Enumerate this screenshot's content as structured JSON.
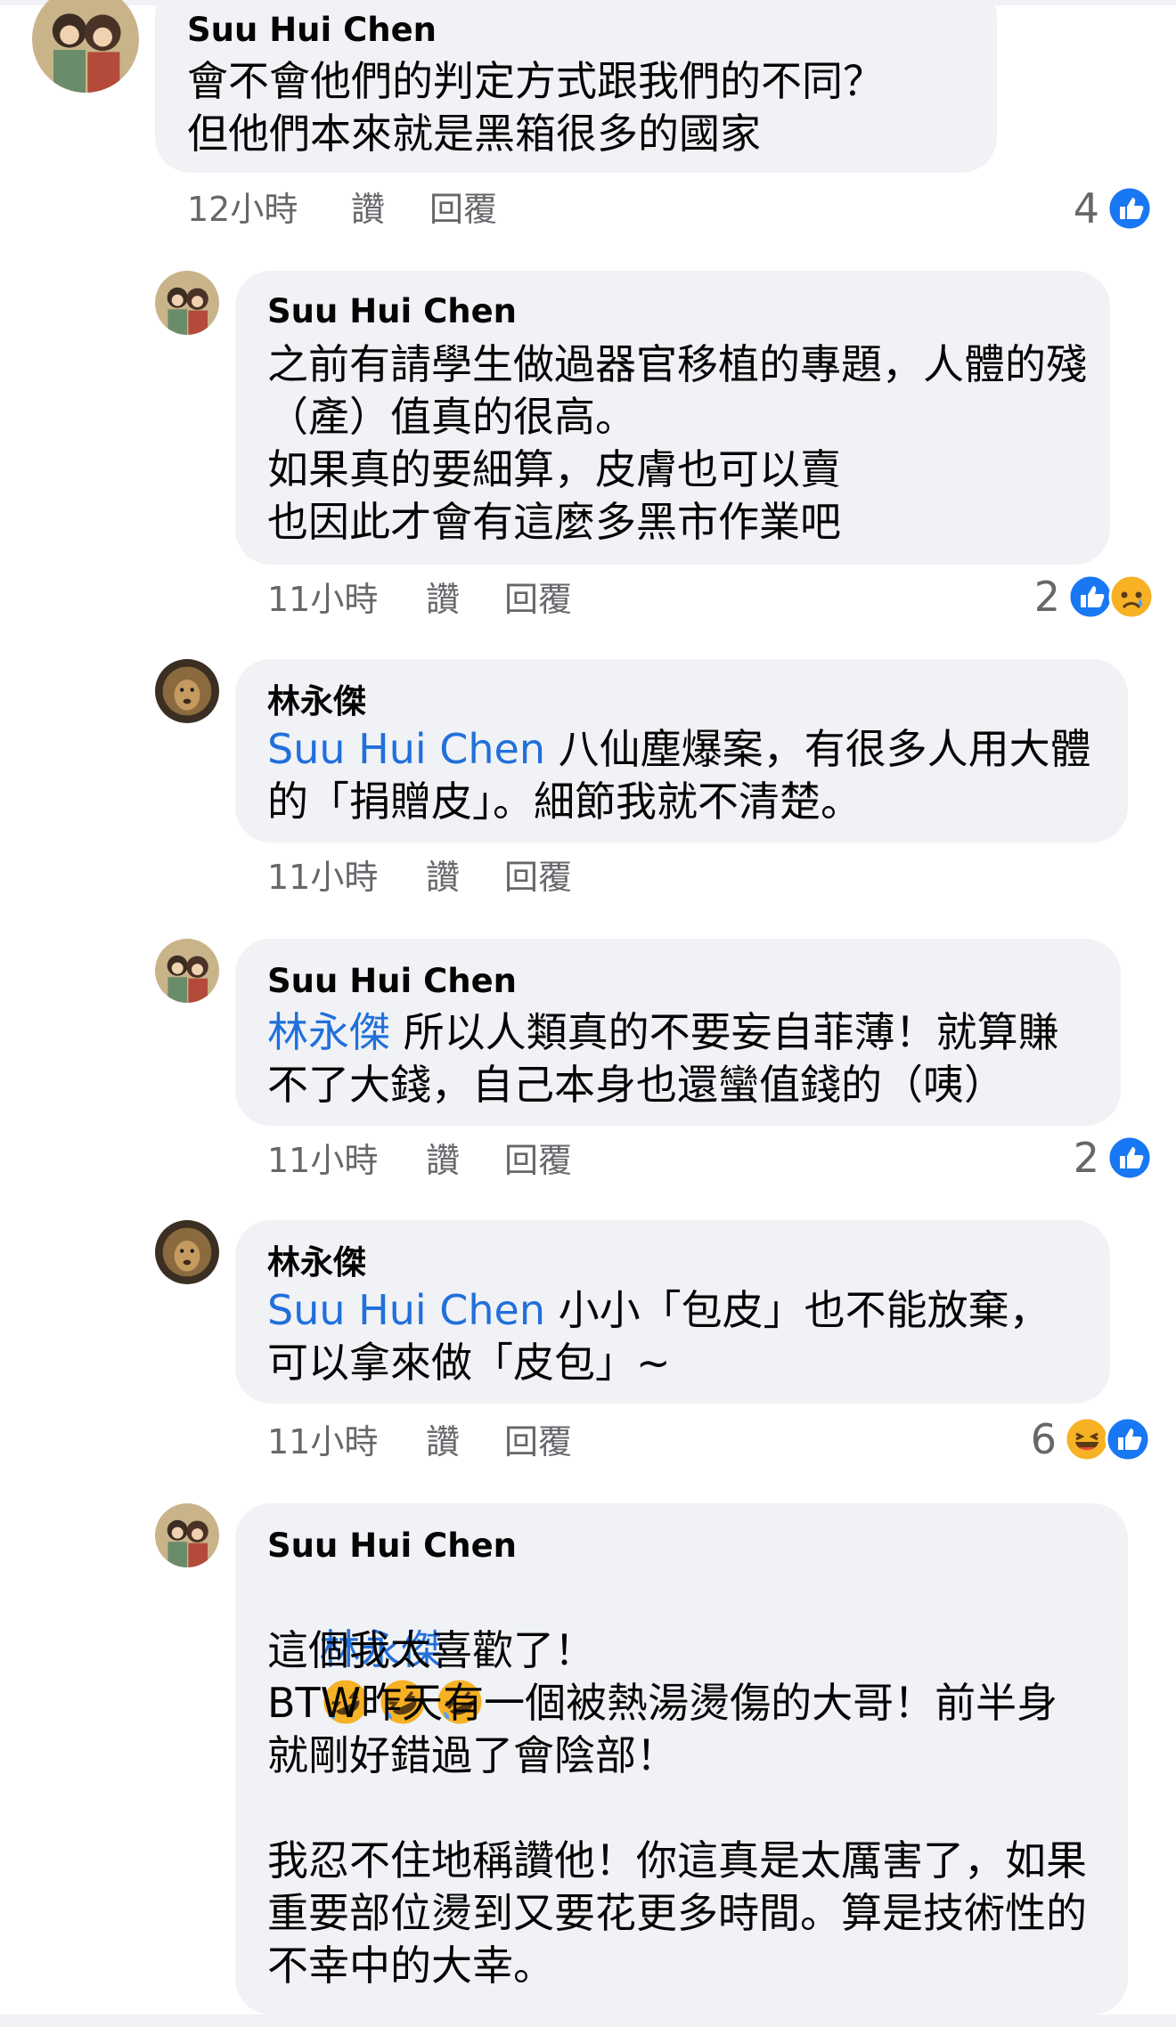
{
  "comments": [
    {
      "author": "Suu Hui Chen",
      "mention": "",
      "text": "會不會他們的判定方式跟我們的不同？\n但他們本來就是黑箱很多的國家",
      "time": "12小時",
      "like_label": "讚",
      "reply_label": "回覆",
      "reaction_count": "4",
      "reactions": [
        "like-icon"
      ]
    },
    {
      "author": "Suu Hui Chen",
      "mention": "",
      "text": "之前有請學生做過器官移植的專題，人體的殘（產）值真的很高。\n如果真的要細算，皮膚也可以賣\n也因此才會有這麼多黑市作業吧",
      "time": "11小時",
      "like_label": "讚",
      "reply_label": "回覆",
      "reaction_count": "2",
      "reactions": [
        "like-icon",
        "sad-icon"
      ]
    },
    {
      "author": "林永傑",
      "mention": "Suu Hui Chen",
      "text": " 八仙塵爆案，有很多人用大體的「捐贈皮」。細節我就不清楚。",
      "time": "11小時",
      "like_label": "讚",
      "reply_label": "回覆",
      "reaction_count": "",
      "reactions": []
    },
    {
      "author": "Suu Hui Chen",
      "mention": "林永傑",
      "text": " 所以人類真的不要妄自菲薄！就算賺不了大錢，自己本身也還蠻值錢的（咦）",
      "time": "11小時",
      "like_label": "讚",
      "reply_label": "回覆",
      "reaction_count": "2",
      "reactions": [
        "like-icon"
      ]
    },
    {
      "author": "林永傑",
      "mention": "Suu Hui Chen",
      "text": " 小小「包皮」也不能放棄，\n可以拿來做「皮包」~",
      "time": "11小時",
      "like_label": "讚",
      "reply_label": "回覆",
      "reaction_count": "6",
      "reactions": [
        "haha-icon",
        "like-icon"
      ]
    },
    {
      "author": "Suu Hui Chen",
      "mention": "林永傑",
      "emoji_count": 3,
      "text": "這個我太喜歡了！\nBTW昨天有一個被熱湯燙傷的大哥！前半身就剛好錯過了會陰部！\n\n我忍不住地稱讚他！你這真是太厲害了，如果重要部位燙到又要花更多時間。算是技術性的不幸中的大幸。",
      "time": "",
      "like_label": "",
      "reply_label": "",
      "reaction_count": "",
      "reactions": []
    }
  ],
  "colors": {
    "bubble": "#f0f2f5",
    "mention": "#216fdb",
    "meta": "#65676b",
    "like": "#1877f2"
  }
}
